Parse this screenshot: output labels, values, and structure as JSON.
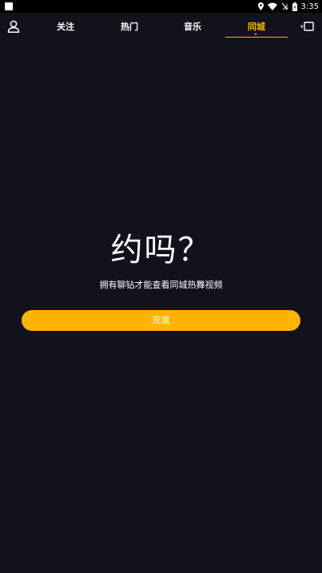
{
  "status_bar": {
    "time": "3:35",
    "icons": [
      "location-icon",
      "wifi-icon",
      "no-sim-icon",
      "battery-icon"
    ]
  },
  "nav": {
    "tabs": [
      {
        "label": "关注",
        "active": false
      },
      {
        "label": "热门",
        "active": false
      },
      {
        "label": "音乐",
        "active": false
      },
      {
        "label": "同城",
        "active": true
      }
    ],
    "left_icon": "profile-icon",
    "right_icon": "cast-icon"
  },
  "main": {
    "headline": "约吗？",
    "subtitle": "拥有聊钻才能查看同城热舞视频",
    "button_label": "充值"
  },
  "colors": {
    "background": "#12121c",
    "accent": "#ffb400",
    "text": "#ffffff"
  }
}
